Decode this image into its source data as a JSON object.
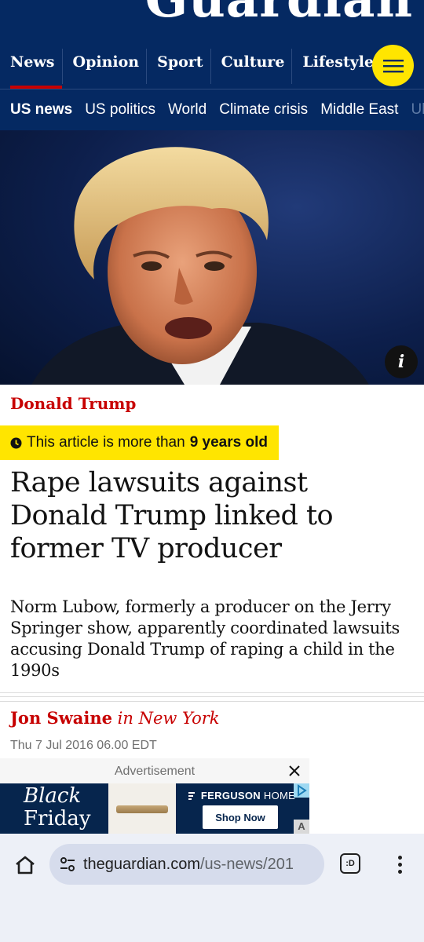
{
  "masthead": {
    "logo_text": "Guardian",
    "pillars": [
      {
        "label": "News",
        "active": true
      },
      {
        "label": "Opinion",
        "active": false
      },
      {
        "label": "Sport",
        "active": false
      },
      {
        "label": "Culture",
        "active": false
      },
      {
        "label": "Lifestyle",
        "active": false
      }
    ],
    "menu_icon": "hamburger-icon"
  },
  "subnav": {
    "items": [
      "US news",
      "US politics",
      "World",
      "Climate crisis",
      "Middle East",
      "Uk"
    ]
  },
  "hero": {
    "info_label": "i"
  },
  "article": {
    "kicker": "Donald Trump",
    "age_warning_prefix": "This article is more than",
    "age_warning_value": "9 years old",
    "headline": "Rape lawsuits against Donald Trump linked to former TV producer",
    "standfirst": "Norm Lubow, formerly a producer on the Jerry Springer show, apparently coordinated lawsuits accusing Donald Trump of raping a child in the 1990s",
    "author": "Jon Swaine",
    "location": "in New York",
    "date": "Thu 7 Jul 2016 06.00 EDT"
  },
  "advert": {
    "label": "Advertisement",
    "banner_line1": "Black",
    "banner_line2": "Friday",
    "brand": "FERGUSON",
    "brand_suffix": "HOME",
    "cta": "Shop Now",
    "badge": "A"
  },
  "browser": {
    "url_host": "theguardian.com",
    "url_path": "/us-news/201",
    "tab_switcher_label": ":D"
  },
  "colors": {
    "brand_blue": "#052962",
    "news_red": "#c70000",
    "highlight_yellow": "#ffe500"
  }
}
